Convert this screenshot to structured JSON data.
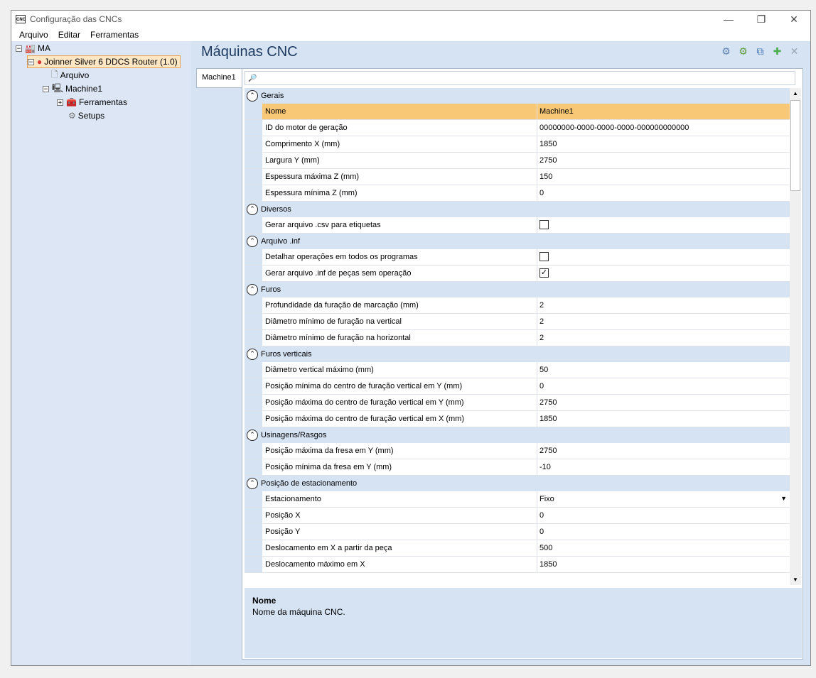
{
  "window": {
    "icon_text": "CNC",
    "title": "Configuração das CNCs",
    "controls": [
      "—",
      "❐",
      "✕"
    ]
  },
  "menu": [
    "Arquivo",
    "Editar",
    "Ferramentas"
  ],
  "tree": [
    {
      "label": "MA",
      "expander": "⊟",
      "icon": "factory-icon",
      "glyph": "🏭"
    },
    {
      "label": "Joinner Silver 6 DDCS Router (1.0)",
      "expander": "⊟",
      "icon": "cnc-brand-icon",
      "glyph": "●"
    },
    {
      "label": "Arquivo",
      "expander": "",
      "icon": "file-icon",
      "glyph": "🗋"
    },
    {
      "label": "Machine1",
      "expander": "⊟",
      "icon": "machine-icon",
      "glyph": "🖳"
    },
    {
      "label": "Ferramentas",
      "expander": "⊞",
      "icon": "toolbox-icon",
      "glyph": "🧰"
    },
    {
      "label": "Setups",
      "expander": "",
      "icon": "gear-icon",
      "glyph": "⚙"
    }
  ],
  "main": {
    "heading": "Máquinas CNC",
    "toolbar_icons": [
      "settings-gear-icon",
      "green-gear-icon",
      "copy-icon",
      "add-icon",
      "delete-icon"
    ],
    "toolbar_glyphs": [
      "⚙",
      "⚙",
      "⧉",
      "✚",
      "✕"
    ],
    "tab": "Machine1",
    "search_icon": "🔎"
  },
  "grid": [
    {
      "type": "cat",
      "label": "Gerais"
    },
    {
      "type": "row",
      "label": "Nome",
      "value": "Machine1",
      "selected": true
    },
    {
      "type": "row",
      "label": "ID do motor de geração",
      "value": "00000000-0000-0000-0000-000000000000"
    },
    {
      "type": "row",
      "label": "Comprimento X (mm)",
      "value": "1850"
    },
    {
      "type": "row",
      "label": "Largura Y (mm)",
      "value": "2750"
    },
    {
      "type": "row",
      "label": "Espessura máxima Z (mm)",
      "value": "150"
    },
    {
      "type": "row",
      "label": "Espessura mínima Z (mm)",
      "value": "0"
    },
    {
      "type": "cat",
      "label": "Diversos"
    },
    {
      "type": "check",
      "label": "Gerar arquivo .csv para etiquetas",
      "checked": false
    },
    {
      "type": "cat",
      "label": "Arquivo .inf"
    },
    {
      "type": "check",
      "label": "Detalhar operações em todos os programas",
      "checked": false
    },
    {
      "type": "check",
      "label": "Gerar arquivo .inf de peças sem operação",
      "checked": true
    },
    {
      "type": "cat",
      "label": "Furos"
    },
    {
      "type": "row",
      "label": "Profundidade da furação de marcação (mm)",
      "value": "2"
    },
    {
      "type": "row",
      "label": "Diâmetro mínimo de furação na vertical",
      "value": "2"
    },
    {
      "type": "row",
      "label": "Diâmetro mínimo de furação na horizontal",
      "value": "2"
    },
    {
      "type": "cat",
      "label": "Furos verticais"
    },
    {
      "type": "row",
      "label": "Diâmetro vertical máximo (mm)",
      "value": "50"
    },
    {
      "type": "row",
      "label": "Posição mínima do centro de furação vertical em Y (mm)",
      "value": "0"
    },
    {
      "type": "row",
      "label": "Posição máxima do centro de furação vertical em Y (mm)",
      "value": "2750"
    },
    {
      "type": "row",
      "label": "Posição máxima do centro de furação vertical em X (mm)",
      "value": "1850"
    },
    {
      "type": "cat",
      "label": "Usinagens/Rasgos"
    },
    {
      "type": "row",
      "label": "Posição máxima da fresa em Y (mm)",
      "value": "2750"
    },
    {
      "type": "row",
      "label": "Posição mínima da fresa em Y (mm)",
      "value": "-10"
    },
    {
      "type": "cat",
      "label": "Posição de estacionamento"
    },
    {
      "type": "dropdown",
      "label": "Estacionamento",
      "value": "Fixo"
    },
    {
      "type": "row",
      "label": "Posição X",
      "value": "0"
    },
    {
      "type": "row",
      "label": "Posição Y",
      "value": "0"
    },
    {
      "type": "row",
      "label": "Deslocamento em X a partir da peça",
      "value": "500"
    },
    {
      "type": "row",
      "label": "Deslocamento máximo em X",
      "value": "1850"
    }
  ],
  "description": {
    "title": "Nome",
    "text": "Nome da máquina CNC."
  }
}
